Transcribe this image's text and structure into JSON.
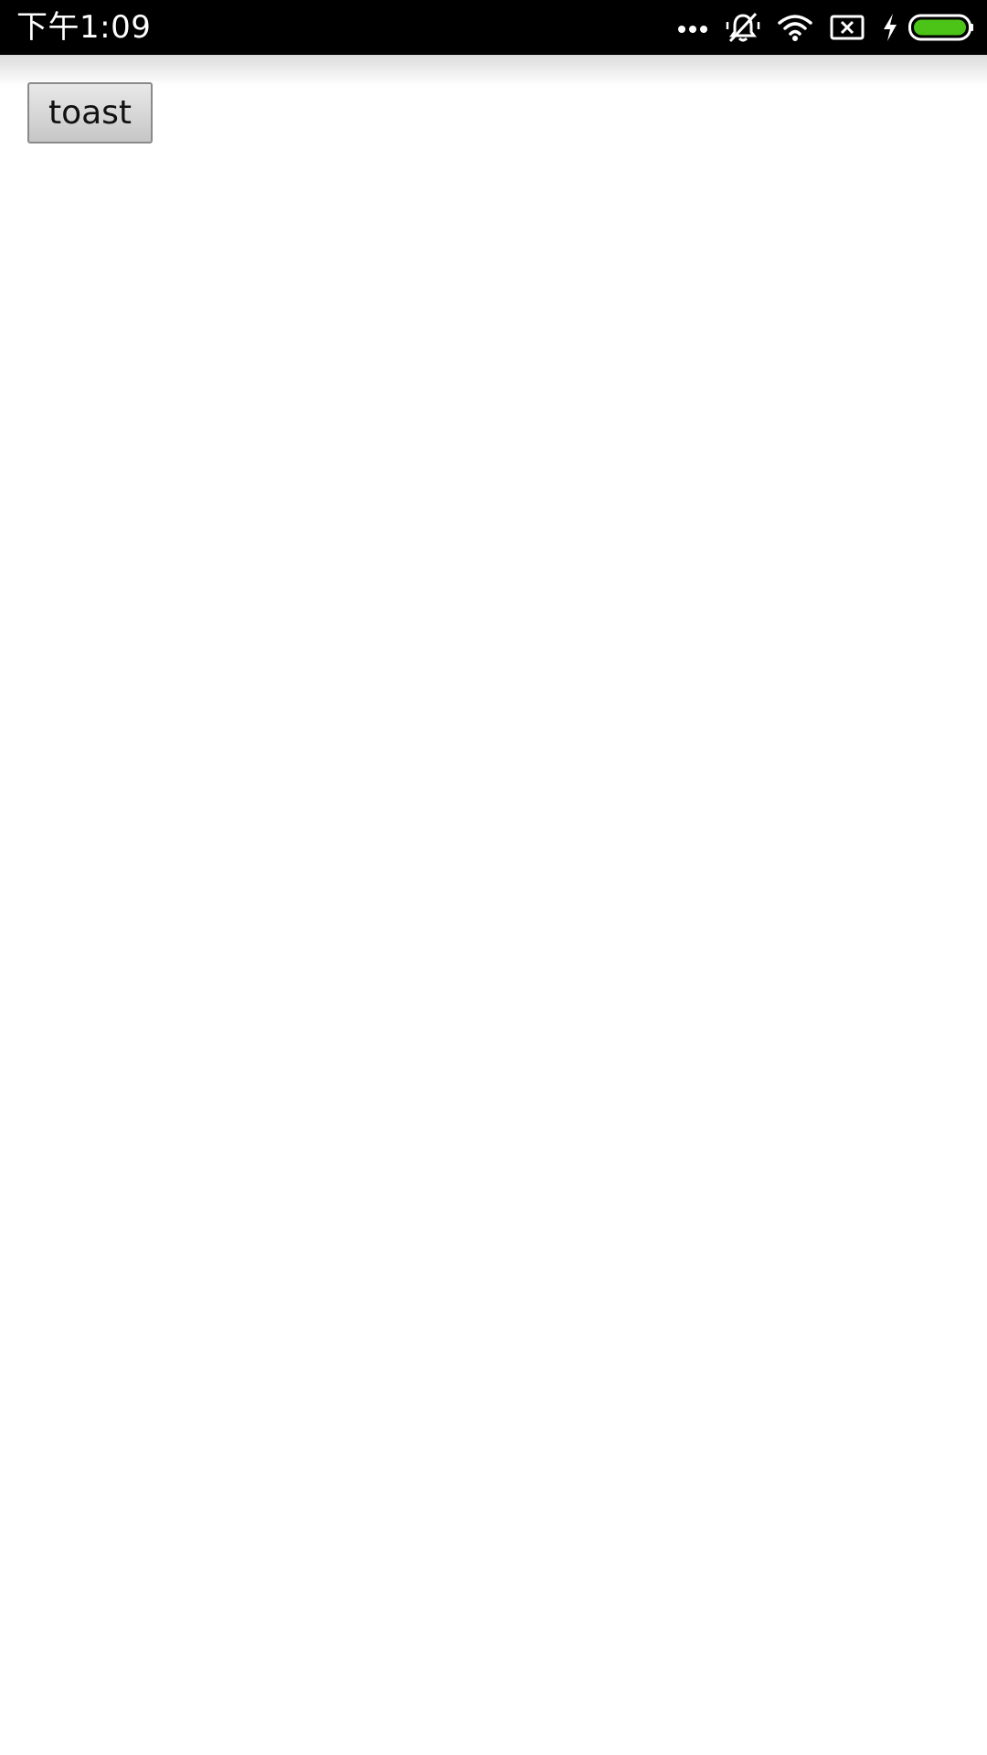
{
  "status_bar": {
    "time": "下午1:09",
    "icons": [
      "more-dots-icon",
      "silent-bell-icon",
      "wifi-icon",
      "sim-blocked-icon",
      "charging-bolt-icon",
      "battery-icon"
    ],
    "battery_color": "#4cc417"
  },
  "main": {
    "toast_button_label": "toast"
  }
}
